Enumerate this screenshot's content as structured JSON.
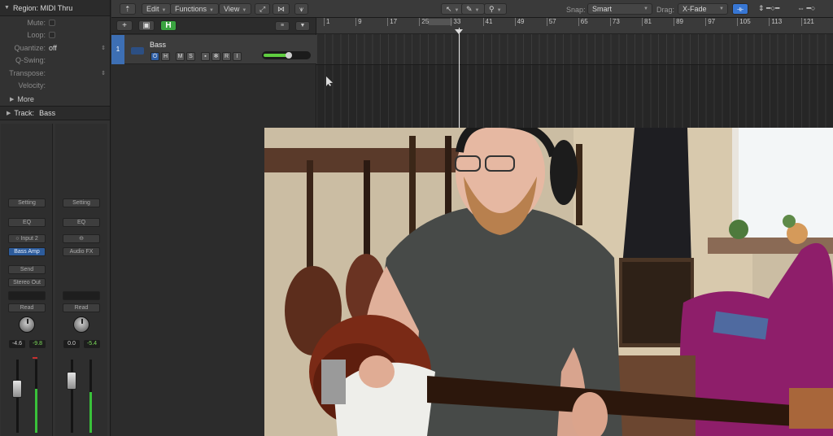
{
  "inspector": {
    "region_header": "Region: MIDI Thru",
    "props": [
      {
        "label": "Mute:",
        "value": "",
        "type": "checkbox"
      },
      {
        "label": "Loop:",
        "value": "",
        "type": "checkbox"
      },
      {
        "label": "Quantize:",
        "value": "off",
        "type": "select"
      },
      {
        "label": "Q-Swing:",
        "value": "",
        "type": "text"
      },
      {
        "label": "Transpose:",
        "value": "",
        "type": "select"
      },
      {
        "label": "Velocity:",
        "value": "",
        "type": "text"
      }
    ],
    "more_label": "More",
    "track_header_label": "Track:",
    "track_header_name": "Bass"
  },
  "strips": [
    {
      "setting": "Setting",
      "eq": "EQ",
      "input": "Input 2",
      "plugin": "Bass Amp",
      "send": "Send",
      "output": "Stereo Out",
      "automation": "Read",
      "pan_value": "-4.6",
      "level_value": "-9.8",
      "meter_level": 0.6
    },
    {
      "setting": "Setting",
      "eq": "EQ",
      "input": "",
      "plugin": "Audio FX",
      "send": "",
      "output": "",
      "automation": "Read",
      "pan_value": "0.0",
      "level_value": "-5.4",
      "meter_level": 0.55
    }
  ],
  "toolbar": {
    "edit": "Edit",
    "functions": "Functions",
    "view": "View",
    "snap_label": "Snap:",
    "snap_value": "Smart",
    "drag_label": "Drag:",
    "drag_value": "X-Fade"
  },
  "tracks_header": {
    "add": "+",
    "h_button": "H"
  },
  "track": {
    "number": "1",
    "name": "Bass",
    "buttons": [
      "H",
      "M",
      "S",
      "R",
      "I"
    ],
    "volume_level": 0.5
  },
  "ruler": {
    "bars": [
      "1",
      "9",
      "17",
      "25",
      "33",
      "41",
      "49",
      "57",
      "65",
      "73",
      "81",
      "89",
      "97",
      "105",
      "113",
      "121"
    ]
  },
  "colors": {
    "accent_blue": "#3d6fb4",
    "record_green": "#3aa340",
    "meter_green": "#39c13a"
  }
}
